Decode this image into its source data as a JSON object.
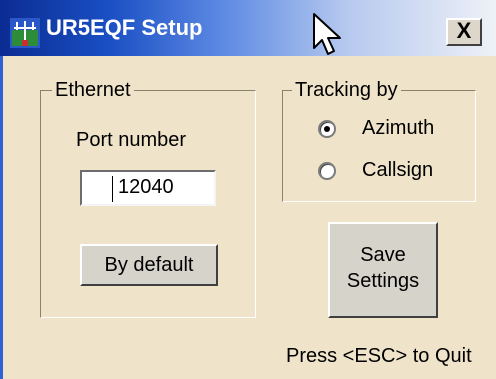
{
  "window": {
    "title": "UR5EQF Setup",
    "close_label": "X"
  },
  "ethernet": {
    "legend": "Ethernet",
    "port_label": "Port number",
    "port_value": "12040",
    "default_button": "By default"
  },
  "tracking": {
    "legend": "Tracking by",
    "options": [
      {
        "label": "Azimuth",
        "selected": true
      },
      {
        "label": "Callsign",
        "selected": false
      }
    ]
  },
  "save_button": {
    "line1": "Save",
    "line2": "Settings"
  },
  "footer": {
    "hint": "Press <ESC> to Quit"
  },
  "colors": {
    "title_gradient_start": "#0b2c92",
    "dialog_bg": "#efe4c9"
  }
}
